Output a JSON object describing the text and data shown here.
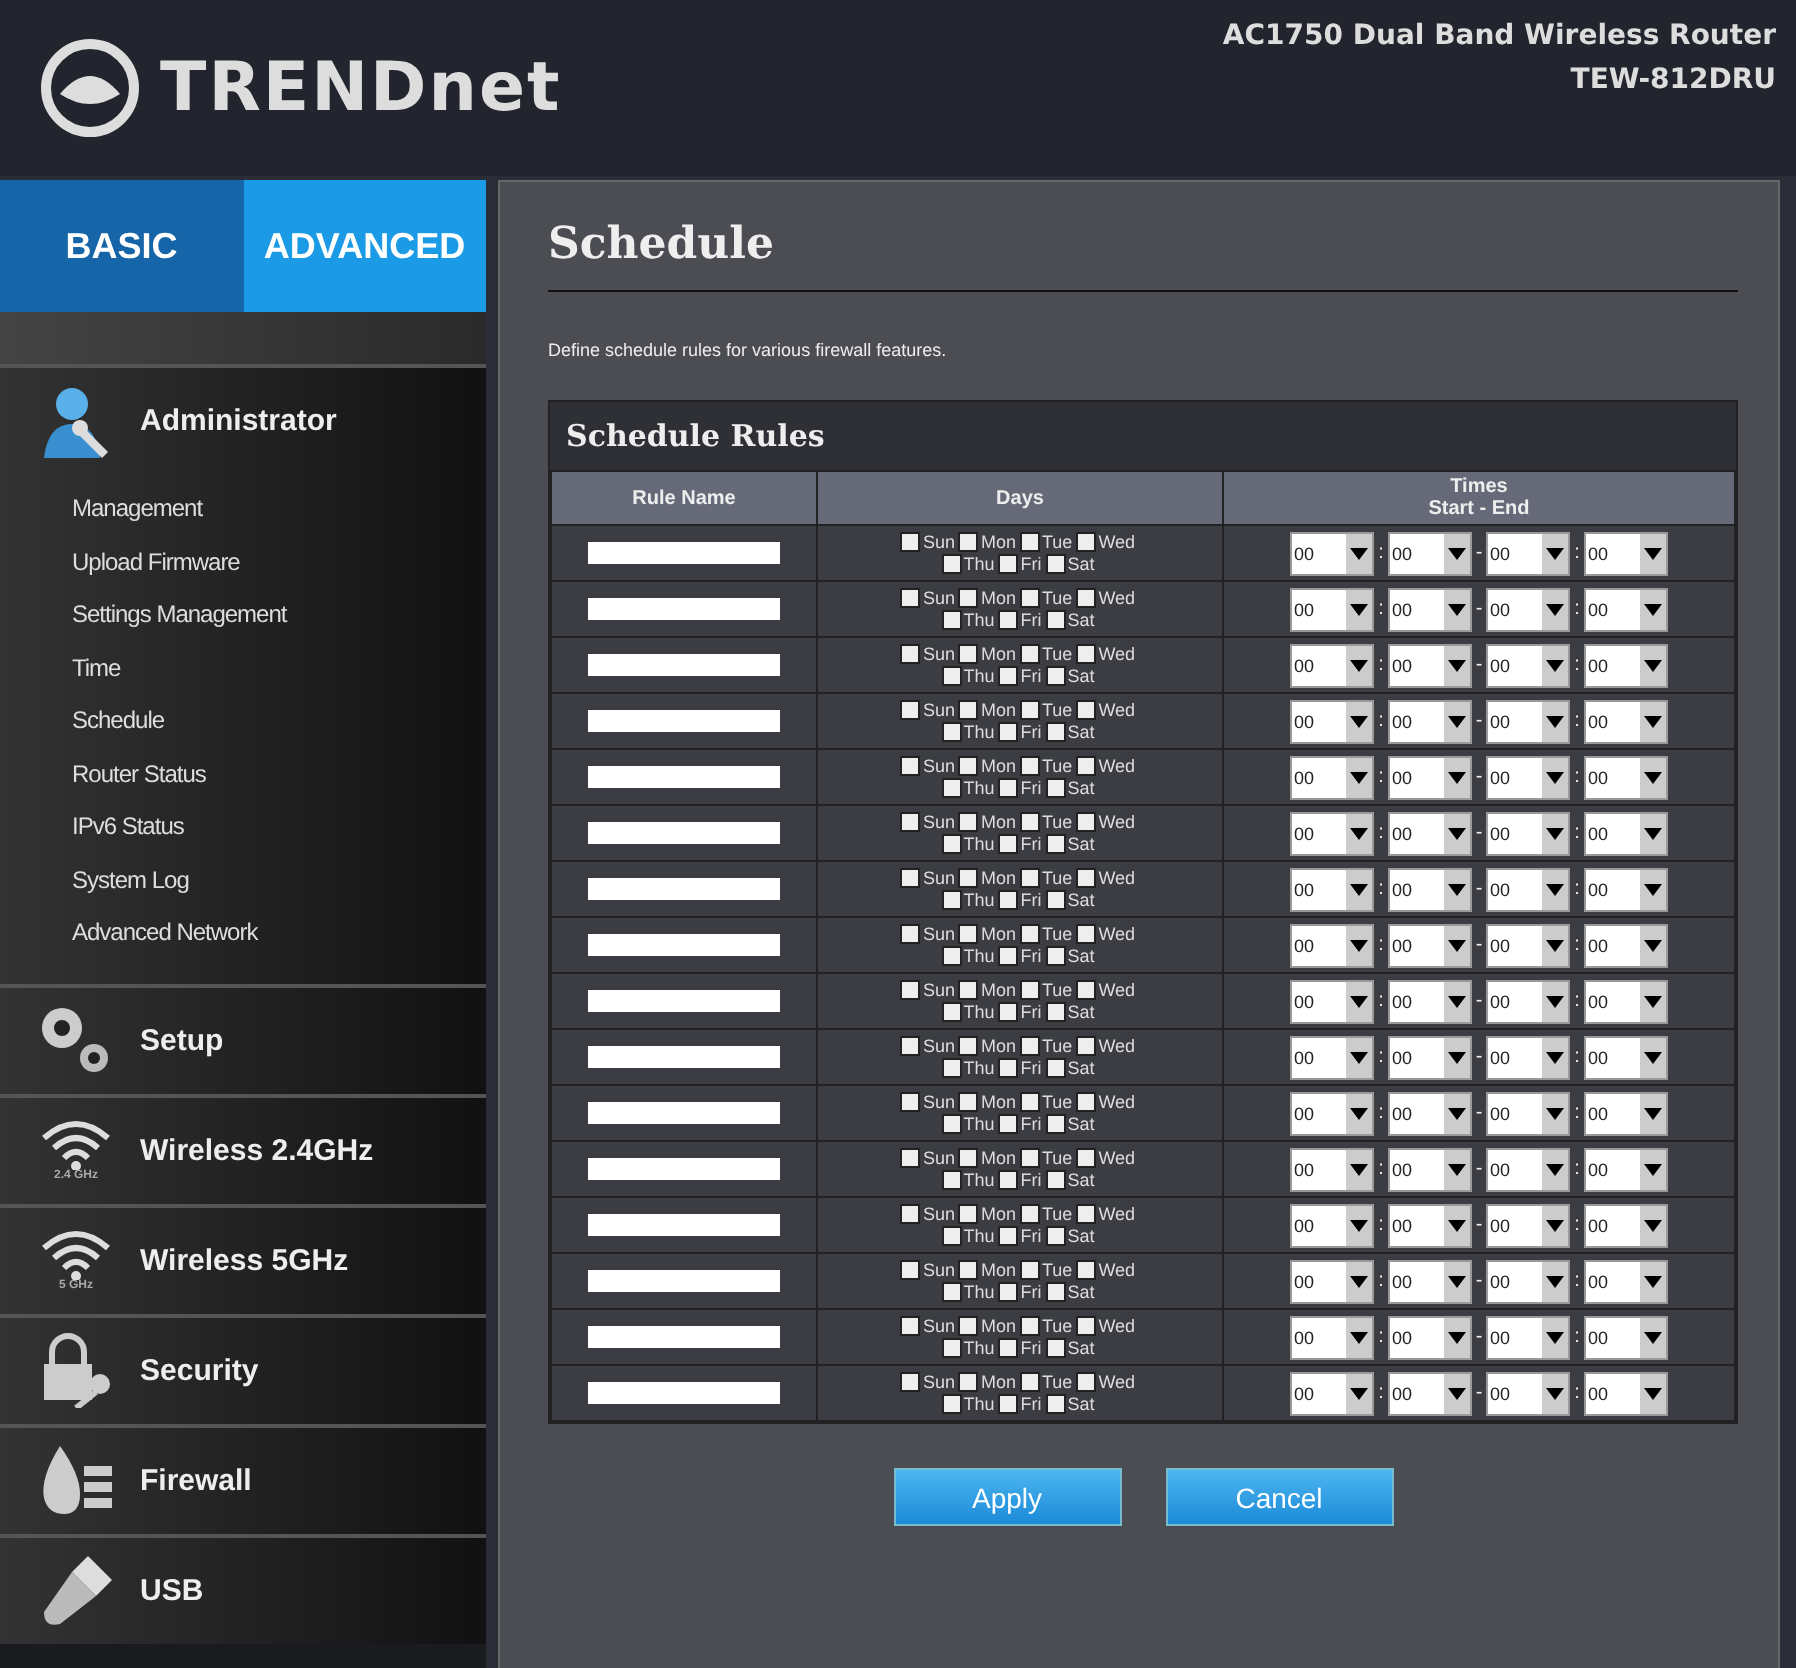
{
  "header": {
    "logo_text": "TRENDnet",
    "product": "AC1750 Dual Band Wireless Router",
    "model": "TEW-812DRU"
  },
  "tabs": [
    {
      "label": "BASIC",
      "selected": false
    },
    {
      "label": "ADVANCED",
      "selected": true
    }
  ],
  "sidebar": [
    {
      "label": "Administrator",
      "kind": "admin",
      "items": [
        "Management",
        "Upload Firmware",
        "Settings Management",
        "Time",
        "Schedule",
        "Router Status",
        "IPv6 Status",
        "System Log",
        "Advanced Network"
      ]
    },
    {
      "label": "Setup",
      "kind": "gears"
    },
    {
      "label": "Wireless 2.4GHz",
      "kind": "wifi",
      "icon_label": "2.4 GHz"
    },
    {
      "label": "Wireless 5GHz",
      "kind": "wifi",
      "icon_label": "5 GHz"
    },
    {
      "label": "Security",
      "kind": "lock"
    },
    {
      "label": "Firewall",
      "kind": "fire"
    },
    {
      "label": "USB",
      "kind": "usb"
    }
  ],
  "page": {
    "title": "Schedule",
    "description": "Define schedule rules for various firewall features.",
    "section_title": "Schedule Rules"
  },
  "table": {
    "columns": [
      "Rule Name",
      "Days",
      "Times"
    ],
    "times_subheading": "Start - End",
    "rows": [
      {
        "days": [
          {
            "label": "Sun",
            "checked": false
          },
          {
            "label": "Mon",
            "checked": false
          },
          {
            "label": "Tue",
            "checked": false
          },
          {
            "label": "Wed",
            "checked": false
          },
          {
            "label": "Thu",
            "checked": false
          },
          {
            "label": "Fri",
            "checked": false
          },
          {
            "label": "Sat",
            "checked": false
          }
        ],
        "times": [
          "00",
          "00",
          "00",
          "00"
        ],
        "separators": [
          ":",
          "-",
          ":"
        ]
      },
      {
        "days": [
          {
            "label": "Sun",
            "checked": false
          },
          {
            "label": "Mon",
            "checked": false
          },
          {
            "label": "Tue",
            "checked": false
          },
          {
            "label": "Wed",
            "checked": false
          },
          {
            "label": "Thu",
            "checked": false
          },
          {
            "label": "Fri",
            "checked": false
          },
          {
            "label": "Sat",
            "checked": false
          }
        ],
        "times": [
          "00",
          "00",
          "00",
          "00"
        ],
        "separators": [
          ":",
          "-",
          ":"
        ]
      },
      {
        "days": [
          {
            "label": "Sun",
            "checked": false
          },
          {
            "label": "Mon",
            "checked": false
          },
          {
            "label": "Tue",
            "checked": false
          },
          {
            "label": "Wed",
            "checked": false
          },
          {
            "label": "Thu",
            "checked": false
          },
          {
            "label": "Fri",
            "checked": false
          },
          {
            "label": "Sat",
            "checked": false
          }
        ],
        "times": [
          "00",
          "00",
          "00",
          "00"
        ],
        "separators": [
          ":",
          "-",
          ":"
        ]
      },
      {
        "days": [
          {
            "label": "Sun",
            "checked": false
          },
          {
            "label": "Mon",
            "checked": false
          },
          {
            "label": "Tue",
            "checked": false
          },
          {
            "label": "Wed",
            "checked": false
          },
          {
            "label": "Thu",
            "checked": false
          },
          {
            "label": "Fri",
            "checked": false
          },
          {
            "label": "Sat",
            "checked": false
          }
        ],
        "times": [
          "00",
          "00",
          "00",
          "00"
        ],
        "separators": [
          ":",
          "-",
          ":"
        ]
      },
      {
        "days": [
          {
            "label": "Sun",
            "checked": false
          },
          {
            "label": "Mon",
            "checked": false
          },
          {
            "label": "Tue",
            "checked": false
          },
          {
            "label": "Wed",
            "checked": false
          },
          {
            "label": "Thu",
            "checked": false
          },
          {
            "label": "Fri",
            "checked": false
          },
          {
            "label": "Sat",
            "checked": false
          }
        ],
        "times": [
          "00",
          "00",
          "00",
          "00"
        ],
        "separators": [
          ":",
          "-",
          ":"
        ]
      },
      {
        "days": [
          {
            "label": "Sun",
            "checked": false
          },
          {
            "label": "Mon",
            "checked": false
          },
          {
            "label": "Tue",
            "checked": false
          },
          {
            "label": "Wed",
            "checked": false
          },
          {
            "label": "Thu",
            "checked": false
          },
          {
            "label": "Fri",
            "checked": false
          },
          {
            "label": "Sat",
            "checked": false
          }
        ],
        "times": [
          "00",
          "00",
          "00",
          "00"
        ],
        "separators": [
          ":",
          "-",
          ":"
        ]
      },
      {
        "days": [
          {
            "label": "Sun",
            "checked": false
          },
          {
            "label": "Mon",
            "checked": false
          },
          {
            "label": "Tue",
            "checked": false
          },
          {
            "label": "Wed",
            "checked": false
          },
          {
            "label": "Thu",
            "checked": false
          },
          {
            "label": "Fri",
            "checked": false
          },
          {
            "label": "Sat",
            "checked": false
          }
        ],
        "times": [
          "00",
          "00",
          "00",
          "00"
        ],
        "separators": [
          ":",
          "-",
          ":"
        ]
      },
      {
        "days": [
          {
            "label": "Sun",
            "checked": false
          },
          {
            "label": "Mon",
            "checked": false
          },
          {
            "label": "Tue",
            "checked": false
          },
          {
            "label": "Wed",
            "checked": false
          },
          {
            "label": "Thu",
            "checked": false
          },
          {
            "label": "Fri",
            "checked": false
          },
          {
            "label": "Sat",
            "checked": false
          }
        ],
        "times": [
          "00",
          "00",
          "00",
          "00"
        ],
        "separators": [
          ":",
          "-",
          ":"
        ]
      },
      {
        "days": [
          {
            "label": "Sun",
            "checked": false
          },
          {
            "label": "Mon",
            "checked": false
          },
          {
            "label": "Tue",
            "checked": false
          },
          {
            "label": "Wed",
            "checked": false
          },
          {
            "label": "Thu",
            "checked": false
          },
          {
            "label": "Fri",
            "checked": false
          },
          {
            "label": "Sat",
            "checked": false
          }
        ],
        "times": [
          "00",
          "00",
          "00",
          "00"
        ],
        "separators": [
          ":",
          "-",
          ":"
        ]
      },
      {
        "days": [
          {
            "label": "Sun",
            "checked": false
          },
          {
            "label": "Mon",
            "checked": false
          },
          {
            "label": "Tue",
            "checked": false
          },
          {
            "label": "Wed",
            "checked": false
          },
          {
            "label": "Thu",
            "checked": false
          },
          {
            "label": "Fri",
            "checked": false
          },
          {
            "label": "Sat",
            "checked": false
          }
        ],
        "times": [
          "00",
          "00",
          "00",
          "00"
        ],
        "separators": [
          ":",
          "-",
          ":"
        ]
      },
      {
        "days": [
          {
            "label": "Sun",
            "checked": false
          },
          {
            "label": "Mon",
            "checked": false
          },
          {
            "label": "Tue",
            "checked": false
          },
          {
            "label": "Wed",
            "checked": false
          },
          {
            "label": "Thu",
            "checked": false
          },
          {
            "label": "Fri",
            "checked": false
          },
          {
            "label": "Sat",
            "checked": false
          }
        ],
        "times": [
          "00",
          "00",
          "00",
          "00"
        ],
        "separators": [
          ":",
          "-",
          ":"
        ]
      },
      {
        "days": [
          {
            "label": "Sun",
            "checked": false
          },
          {
            "label": "Mon",
            "checked": false
          },
          {
            "label": "Tue",
            "checked": false
          },
          {
            "label": "Wed",
            "checked": false
          },
          {
            "label": "Thu",
            "checked": false
          },
          {
            "label": "Fri",
            "checked": false
          },
          {
            "label": "Sat",
            "checked": false
          }
        ],
        "times": [
          "00",
          "00",
          "00",
          "00"
        ],
        "separators": [
          ":",
          "-",
          ":"
        ]
      },
      {
        "days": [
          {
            "label": "Sun",
            "checked": false
          },
          {
            "label": "Mon",
            "checked": false
          },
          {
            "label": "Tue",
            "checked": false
          },
          {
            "label": "Wed",
            "checked": false
          },
          {
            "label": "Thu",
            "checked": false
          },
          {
            "label": "Fri",
            "checked": false
          },
          {
            "label": "Sat",
            "checked": false
          }
        ],
        "times": [
          "00",
          "00",
          "00",
          "00"
        ],
        "separators": [
          ":",
          "-",
          ":"
        ]
      },
      {
        "days": [
          {
            "label": "Sun",
            "checked": false
          },
          {
            "label": "Mon",
            "checked": false
          },
          {
            "label": "Tue",
            "checked": false
          },
          {
            "label": "Wed",
            "checked": false
          },
          {
            "label": "Thu",
            "checked": false
          },
          {
            "label": "Fri",
            "checked": false
          },
          {
            "label": "Sat",
            "checked": false
          }
        ],
        "times": [
          "00",
          "00",
          "00",
          "00"
        ],
        "separators": [
          ":",
          "-",
          ":"
        ]
      },
      {
        "days": [
          {
            "label": "Sun",
            "checked": false
          },
          {
            "label": "Mon",
            "checked": false
          },
          {
            "label": "Tue",
            "checked": false
          },
          {
            "label": "Wed",
            "checked": false
          },
          {
            "label": "Thu",
            "checked": false
          },
          {
            "label": "Fri",
            "checked": false
          },
          {
            "label": "Sat",
            "checked": false
          }
        ],
        "times": [
          "00",
          "00",
          "00",
          "00"
        ],
        "separators": [
          ":",
          "-",
          ":"
        ]
      },
      {
        "days": [
          {
            "label": "Sun",
            "checked": false
          },
          {
            "label": "Mon",
            "checked": false
          },
          {
            "label": "Tue",
            "checked": false
          },
          {
            "label": "Wed",
            "checked": false
          },
          {
            "label": "Thu",
            "checked": false
          },
          {
            "label": "Fri",
            "checked": false
          },
          {
            "label": "Sat",
            "checked": false
          }
        ],
        "times": [
          "00",
          "00",
          "00",
          "00"
        ],
        "separators": [
          ":",
          "-",
          ":"
        ]
      }
    ]
  },
  "buttons": [
    "Apply",
    "Cancel"
  ]
}
